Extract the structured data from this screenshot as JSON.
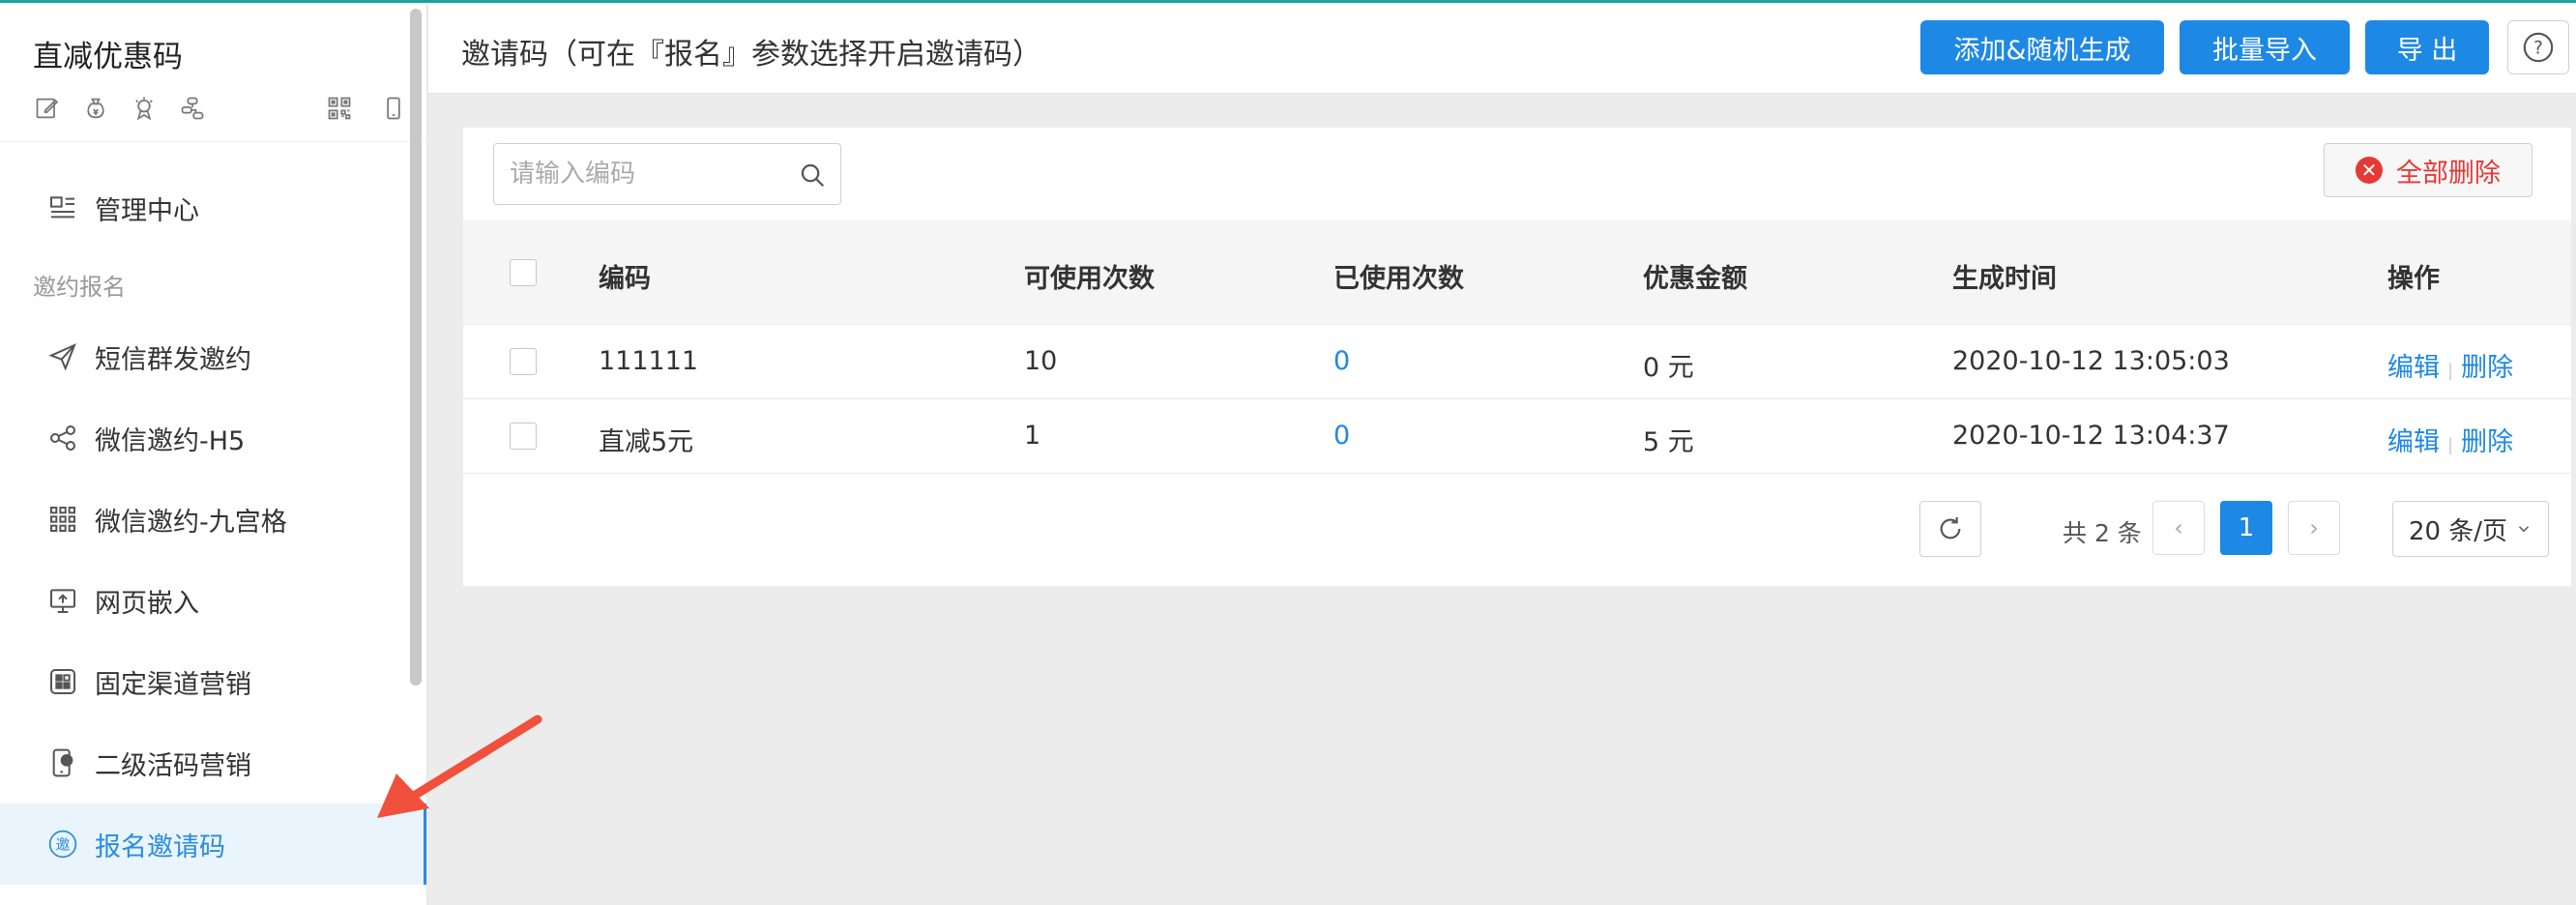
{
  "sidebar": {
    "title": "直减优惠码",
    "group_label": "邀约报名",
    "items": [
      {
        "label": "管理中心",
        "icon": "dashboard-icon"
      },
      {
        "label": "短信群发邀约",
        "icon": "send-icon"
      },
      {
        "label": "微信邀约-H5",
        "icon": "share-icon"
      },
      {
        "label": "微信邀约-九宫格",
        "icon": "grid-icon"
      },
      {
        "label": "网页嵌入",
        "icon": "monitor-icon"
      },
      {
        "label": "固定渠道营销",
        "icon": "channel-icon"
      },
      {
        "label": "二级活码营销",
        "icon": "phone-qr-icon"
      },
      {
        "label": "报名邀请码",
        "icon": "invite-icon",
        "icon_glyph": "邀"
      }
    ]
  },
  "header": {
    "title": "邀请码（可在『报名』参数选择开启邀请码）",
    "add_button": "添加&随机生成",
    "import_button": "批量导入",
    "export_button": "导 出",
    "help_label": "?"
  },
  "search": {
    "placeholder": "请输入编码",
    "value": ""
  },
  "delete_all_label": "全部删除",
  "table": {
    "columns": [
      "编码",
      "可使用次数",
      "已使用次数",
      "优惠金额",
      "生成时间",
      "操作"
    ],
    "rows": [
      {
        "code": "111111",
        "available": "10",
        "used": "0",
        "amount": "0 元",
        "created": "2020-10-12 13:05:03",
        "edit": "编辑",
        "delete": "删除"
      },
      {
        "code": "直减5元",
        "available": "1",
        "used": "0",
        "amount": "5 元",
        "created": "2020-10-12 13:04:37",
        "edit": "编辑",
        "delete": "删除"
      }
    ]
  },
  "pager": {
    "total_text": "共 2 条",
    "prev": "‹",
    "current": "1",
    "next": "›",
    "page_size": "20 条/页"
  },
  "colors": {
    "accent": "#1e88e5",
    "danger": "#e53935",
    "active_bg": "#e9f4fd",
    "annotation_arrow": "#f0503c"
  }
}
